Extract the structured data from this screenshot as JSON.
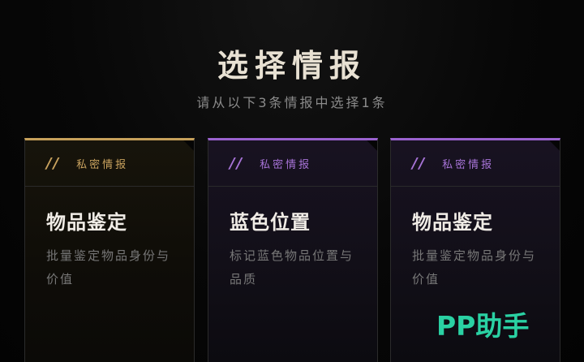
{
  "header": {
    "title": "选择情报",
    "subtitle": "请从以下3条情报中选择1条"
  },
  "cards": [
    {
      "slash": "//",
      "tag": "私密情报",
      "title": "物品鉴定",
      "description": "批量鉴定物品身份与价值",
      "accent": "#c6a05b"
    },
    {
      "slash": "//",
      "tag": "私密情报",
      "title": "蓝色位置",
      "description": "标记蓝色物品位置与品质",
      "accent": "#9a62ce"
    },
    {
      "slash": "//",
      "tag": "私密情报",
      "title": "物品鉴定",
      "description": "批量鉴定物品身份与价值",
      "accent": "#9a62ce"
    }
  ],
  "watermark": {
    "text": "PP助手"
  }
}
